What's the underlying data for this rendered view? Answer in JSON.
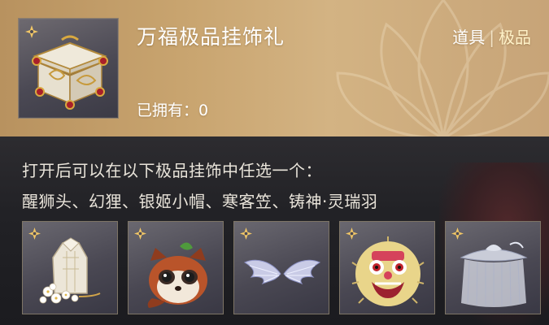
{
  "header": {
    "title": "万福极品挂饰礼",
    "category": "道具",
    "separator": "|",
    "grade": "极品",
    "owned_label": "已拥有：0"
  },
  "description": {
    "line1": "打开后可以在以下极品挂饰中任选一个：",
    "line2": "醒狮头、幻狸、银姬小帽、寒客笠、铸神·灵瑞羽"
  },
  "choices": [
    {
      "icon": "crystal-headpiece-icon"
    },
    {
      "icon": "raccoon-pet-icon"
    },
    {
      "icon": "silver-wings-icon"
    },
    {
      "icon": "lion-dance-head-icon"
    },
    {
      "icon": "veiled-hat-icon"
    }
  ],
  "colors": {
    "header_gold": "#c9a570",
    "body_dark": "#222226",
    "frame_border": "#8d7e6c",
    "star_gold": "#f2c766"
  }
}
